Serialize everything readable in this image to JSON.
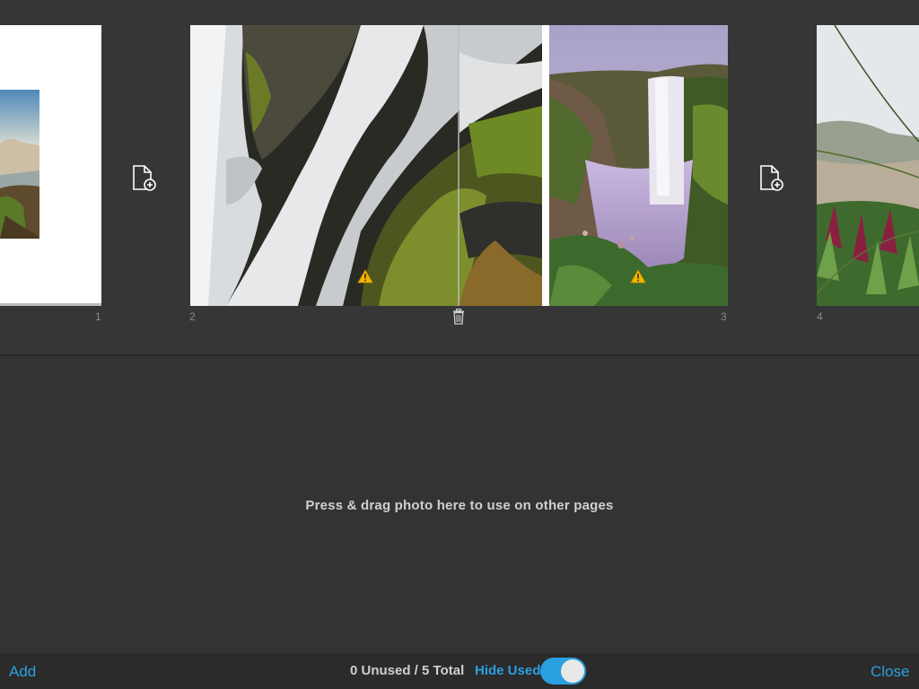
{
  "page_strip": {
    "pages": [
      {
        "number": "1"
      },
      {
        "number": "2"
      },
      {
        "number": "3"
      },
      {
        "number": "4"
      }
    ]
  },
  "tray": {
    "empty_message": "Press & drag photo here to use on other pages"
  },
  "toolbar": {
    "add_label": "Add",
    "photo_count": "0 Unused / 5 Total",
    "hide_used_label": "Hide Used",
    "hide_used_on": true,
    "close_label": "Close"
  },
  "colors": {
    "accent": "#2aa0e0",
    "background": "#333333",
    "warning": "#f5b400"
  },
  "icons": {
    "add_page": "add-page-icon",
    "warning": "warning-icon",
    "delete": "trash-icon"
  }
}
